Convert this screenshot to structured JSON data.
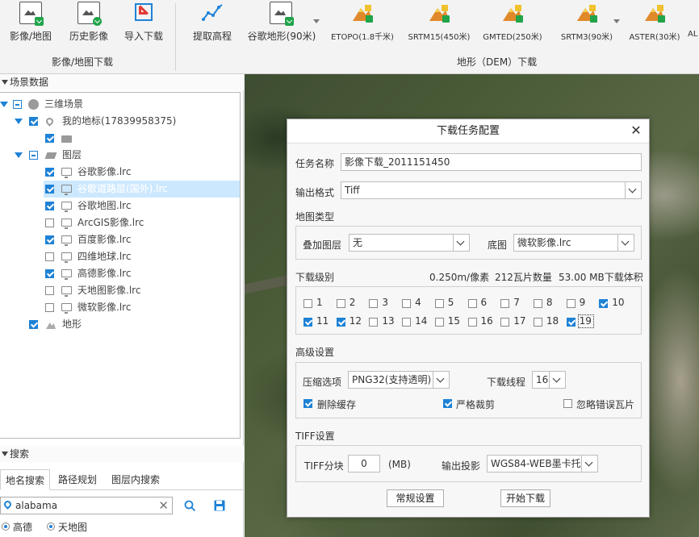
{
  "ribbon": {
    "image_group": {
      "label": "影像/地图下载",
      "buttons": [
        {
          "label": "影像/地图"
        },
        {
          "label": "历史影像"
        },
        {
          "label": "导入下载"
        }
      ]
    },
    "dem_group": {
      "label": "地形（DEM）下载",
      "buttons": [
        {
          "label": "提取高程"
        },
        {
          "label": "谷歌地形(90米)"
        },
        {
          "label": "ETOPO(1.8千米)"
        },
        {
          "label": "SRTM15(450米)"
        },
        {
          "label": "GMTED(250米)"
        },
        {
          "label": "SRTM3(90米)"
        },
        {
          "label": "ASTER(30米)"
        },
        {
          "label": "AL"
        }
      ]
    }
  },
  "scene_panel": {
    "title": "场景数据",
    "nodes": [
      {
        "label": "三维场景"
      },
      {
        "label": "我的地标(17839958375)"
      },
      {
        "label": ""
      },
      {
        "label": "图层"
      },
      {
        "label": "谷歌影像.lrc"
      },
      {
        "label": "谷歌道路层(国外).lrc"
      },
      {
        "label": "谷歌地图.lrc"
      },
      {
        "label": "ArcGIS影像.lrc"
      },
      {
        "label": "百度影像.lrc"
      },
      {
        "label": "四维地球.lrc"
      },
      {
        "label": "高德影像.lrc"
      },
      {
        "label": "天地图影像.lrc"
      },
      {
        "label": "微软影像.lrc"
      },
      {
        "label": "地形"
      }
    ]
  },
  "search_panel": {
    "title": "搜索",
    "tabs": [
      "地名搜索",
      "路径规划",
      "图层内搜索"
    ],
    "query": "alabama",
    "sources": [
      "高德",
      "天地图"
    ]
  },
  "dialog": {
    "title": "下载任务配置",
    "task_name_label": "任务名称",
    "task_name_value": "影像下载_2011151450",
    "format_label": "输出格式",
    "format_value": "Tiff",
    "map_type_label": "地图类型",
    "overlay_label": "叠加图层",
    "overlay_value": "无",
    "base_label": "底图",
    "base_value": "微软影像.lrc",
    "level_label": "下载级别",
    "resolution": "0.250m/像素",
    "tile_count": "212瓦片数量",
    "volume": "53.00 MB下载体积",
    "levels": [
      {
        "n": "1"
      },
      {
        "n": "2"
      },
      {
        "n": "3"
      },
      {
        "n": "4"
      },
      {
        "n": "5"
      },
      {
        "n": "6"
      },
      {
        "n": "7"
      },
      {
        "n": "8"
      },
      {
        "n": "9"
      },
      {
        "n": "10"
      },
      {
        "n": "11"
      },
      {
        "n": "12"
      },
      {
        "n": "13"
      },
      {
        "n": "14"
      },
      {
        "n": "15"
      },
      {
        "n": "16"
      },
      {
        "n": "17"
      },
      {
        "n": "18"
      },
      {
        "n": "19"
      }
    ],
    "advanced_label": "高级设置",
    "compress_label": "压缩选项",
    "compress_value": "PNG32(支持透明)",
    "threads_label": "下载线程",
    "threads_value": "16",
    "delete_cache_label": "删除缓存",
    "strict_crop_label": "严格裁剪",
    "ignore_error_label": "忽略错误瓦片",
    "tiff_label": "TIFF设置",
    "tiff_block_label": "TIFF分块",
    "tiff_block_value": "0",
    "tiff_block_unit": "(MB)",
    "projection_label": "输出投影",
    "projection_value": "WGS84-WEB墨卡托",
    "normal_settings_button": "常规设置",
    "start_download_button": "开始下载"
  },
  "colors": {
    "accent": "#1e82d6",
    "selection": "#cce8ff",
    "badge_green": "#21a44a"
  }
}
